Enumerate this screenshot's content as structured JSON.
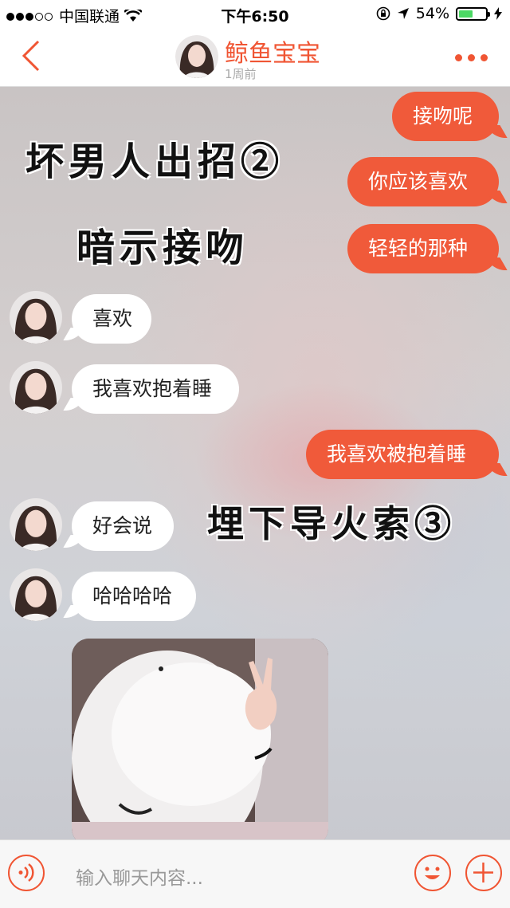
{
  "status_bar": {
    "carrier": "中国联通",
    "time": "下午6:50",
    "battery": "54%",
    "battery_level": 0.54
  },
  "header": {
    "contact_name": "鲸鱼宝宝",
    "last_seen": "1周前"
  },
  "overlay_texts": [
    "坏男人出招②",
    "暗示接吻",
    "埋下导火索③"
  ],
  "messages": [
    {
      "side": "out",
      "text": "接吻呢"
    },
    {
      "side": "out",
      "text": "你应该喜欢"
    },
    {
      "side": "out",
      "text": "轻轻的那种"
    },
    {
      "side": "in",
      "text": "喜欢"
    },
    {
      "side": "in",
      "text": "我喜欢抱着睡"
    },
    {
      "side": "out",
      "text": "我喜欢被抱着睡"
    },
    {
      "side": "in",
      "text": "好会说"
    },
    {
      "side": "in",
      "text": "哈哈哈哈"
    }
  ],
  "input": {
    "placeholder": "输入聊天内容..."
  },
  "colors": {
    "accent": "#f05533",
    "bubble_out": "#f05a3a",
    "bubble_in": "#ffffff"
  },
  "icons": [
    "back-chevron-icon",
    "more-dots-icon",
    "voice-icon",
    "emoji-icon",
    "plus-icon",
    "wifi-icon",
    "location-arrow-icon",
    "lock-rotation-icon",
    "battery-icon"
  ]
}
